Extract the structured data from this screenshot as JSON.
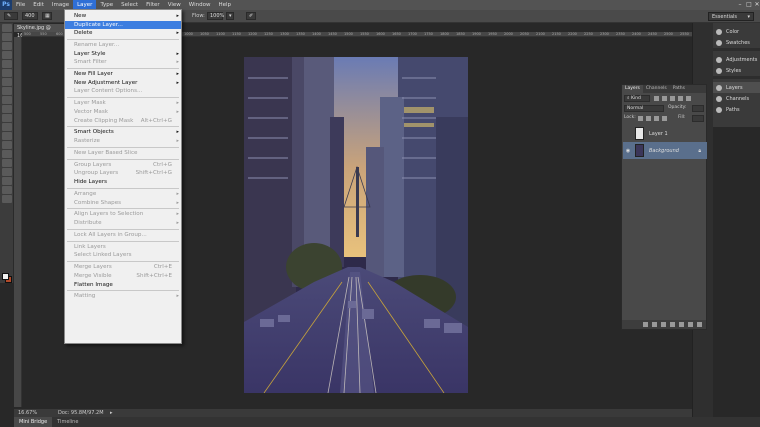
{
  "menubar": {
    "logo": "Ps",
    "items": [
      "File",
      "Edit",
      "Image",
      "Layer",
      "Type",
      "Select",
      "Filter",
      "View",
      "Window",
      "Help"
    ],
    "active": "Layer",
    "minimize": "–",
    "maximize": "□",
    "close": "✕"
  },
  "options": {
    "size_value": "400",
    "flow_label": "Flow:",
    "flow_value": "100%",
    "workspace": "Essentials"
  },
  "document": {
    "tab_title": "Skyline.jpg @ 16.7%",
    "ruler_ticks": [
      "500",
      "550",
      "600",
      "650",
      "700",
      "750",
      "800",
      "850",
      "900",
      "950",
      "1000",
      "1050",
      "1100",
      "1150",
      "1200",
      "1250",
      "1300",
      "1350",
      "1400",
      "1450",
      "1500",
      "1550",
      "1600",
      "1650",
      "1700",
      "1750",
      "1800",
      "1850",
      "1900",
      "1950",
      "2000",
      "2050",
      "2100",
      "2150",
      "2200",
      "2250",
      "2300",
      "2350",
      "2400",
      "2450",
      "2500",
      "2550"
    ],
    "zoom": "16.67%",
    "doc_info": "Doc: 95.8M/97.2M"
  },
  "bottom_tabs": [
    "Mini Bridge",
    "Timeline"
  ],
  "dock": {
    "group1": [
      "Color",
      "Swatches"
    ],
    "group2": [
      "Adjustments",
      "Styles"
    ],
    "group3": [
      "Layers",
      "Channels",
      "Paths"
    ]
  },
  "layers_panel": {
    "tabs": [
      "Layers",
      "Channels",
      "Paths"
    ],
    "kind": "Kind",
    "blend_mode": "Normal",
    "opacity_label": "Opacity:",
    "lock_label": "Lock:",
    "fill_label": "Fill:",
    "layers": [
      {
        "name": "Layer 1",
        "visible": false,
        "selected": false
      },
      {
        "name": "Background",
        "visible": true,
        "selected": true
      }
    ]
  },
  "layer_menu": {
    "items": [
      {
        "label": "New",
        "arrow": true,
        "disabled": false,
        "shortcut": ""
      },
      {
        "label": "Duplicate Layer...",
        "highlighted": true,
        "disabled": false,
        "shortcut": ""
      },
      {
        "label": "Delete",
        "arrow": true,
        "disabled": false,
        "shortcut": ""
      },
      {
        "sep": true
      },
      {
        "label": "Rename Layer...",
        "disabled": true,
        "shortcut": ""
      },
      {
        "label": "Layer Style",
        "arrow": true,
        "disabled": false,
        "shortcut": ""
      },
      {
        "label": "Smart Filter",
        "arrow": true,
        "disabled": true,
        "shortcut": ""
      },
      {
        "sep": true
      },
      {
        "label": "New Fill Layer",
        "arrow": true,
        "disabled": false,
        "shortcut": ""
      },
      {
        "label": "New Adjustment Layer",
        "arrow": true,
        "disabled": false,
        "shortcut": ""
      },
      {
        "label": "Layer Content Options...",
        "disabled": true,
        "shortcut": ""
      },
      {
        "sep": true
      },
      {
        "label": "Layer Mask",
        "arrow": true,
        "disabled": true,
        "shortcut": ""
      },
      {
        "label": "Vector Mask",
        "arrow": true,
        "disabled": true,
        "shortcut": ""
      },
      {
        "label": "Create Clipping Mask",
        "disabled": true,
        "shortcut": "Alt+Ctrl+G"
      },
      {
        "sep": true
      },
      {
        "label": "Smart Objects",
        "arrow": true,
        "disabled": false,
        "shortcut": ""
      },
      {
        "label": "Rasterize",
        "arrow": true,
        "disabled": true,
        "shortcut": ""
      },
      {
        "sep": true
      },
      {
        "label": "New Layer Based Slice",
        "disabled": true,
        "shortcut": ""
      },
      {
        "sep": true
      },
      {
        "label": "Group Layers",
        "disabled": true,
        "shortcut": "Ctrl+G"
      },
      {
        "label": "Ungroup Layers",
        "disabled": true,
        "shortcut": "Shift+Ctrl+G"
      },
      {
        "label": "Hide Layers",
        "disabled": false,
        "shortcut": ""
      },
      {
        "sep": true
      },
      {
        "label": "Arrange",
        "arrow": true,
        "disabled": true,
        "shortcut": ""
      },
      {
        "label": "Combine Shapes",
        "arrow": true,
        "disabled": true,
        "shortcut": ""
      },
      {
        "sep": true
      },
      {
        "label": "Align Layers to Selection",
        "arrow": true,
        "disabled": true,
        "shortcut": ""
      },
      {
        "label": "Distribute",
        "arrow": true,
        "disabled": true,
        "shortcut": ""
      },
      {
        "sep": true
      },
      {
        "label": "Lock All Layers in Group...",
        "disabled": true,
        "shortcut": ""
      },
      {
        "sep": true
      },
      {
        "label": "Link Layers",
        "disabled": true,
        "shortcut": ""
      },
      {
        "label": "Select Linked Layers",
        "disabled": true,
        "shortcut": ""
      },
      {
        "sep": true
      },
      {
        "label": "Merge Layers",
        "disabled": true,
        "shortcut": "Ctrl+E"
      },
      {
        "label": "Merge Visible",
        "disabled": true,
        "shortcut": "Shift+Ctrl+E"
      },
      {
        "label": "Flatten Image",
        "disabled": false,
        "shortcut": ""
      },
      {
        "sep": true
      },
      {
        "label": "Matting",
        "arrow": true,
        "disabled": true,
        "shortcut": ""
      }
    ]
  },
  "colors": {
    "accent": "#3d7ee0",
    "foreground": "#f2f2f2",
    "background_swatch": "#b14a2a"
  }
}
